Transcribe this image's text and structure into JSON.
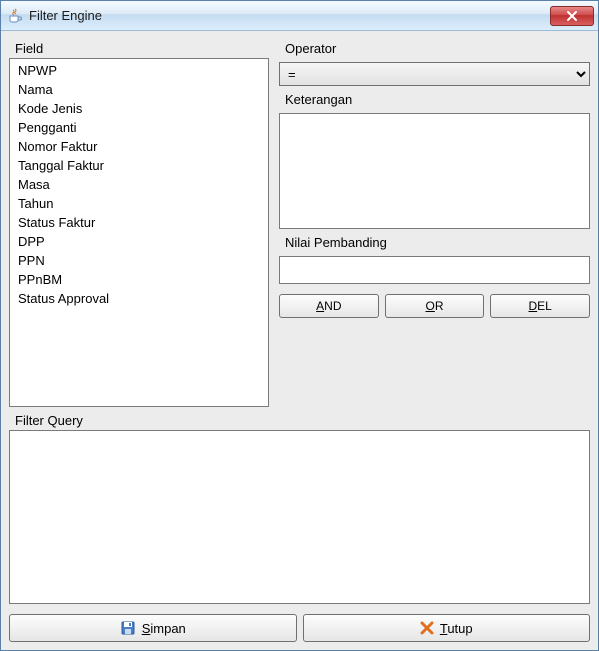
{
  "window": {
    "title": "Filter Engine"
  },
  "labels": {
    "field": "Field",
    "operator": "Operator",
    "keterangan": "Keterangan",
    "nilai_pembanding": "Nilai Pembanding",
    "filter_query": "Filter Query"
  },
  "field_list": [
    "NPWP",
    "Nama",
    "Kode Jenis",
    "Pengganti",
    "Nomor Faktur",
    "Tanggal Faktur",
    "Masa",
    "Tahun",
    "Status Faktur",
    "DPP",
    "PPN",
    "PPnBM",
    "Status Approval"
  ],
  "operator": {
    "selected": "=",
    "options": [
      "="
    ]
  },
  "keterangan_value": "",
  "nilai_pembanding_value": "",
  "filter_query_value": "",
  "buttons": {
    "and": "AND",
    "or": "OR",
    "del": "DEL",
    "simpan": "Simpan",
    "tutup": "Tutup"
  },
  "icons": {
    "app": "java-cup-icon",
    "close": "close-icon",
    "save": "floppy-disk-icon",
    "cancel": "cross-icon"
  }
}
